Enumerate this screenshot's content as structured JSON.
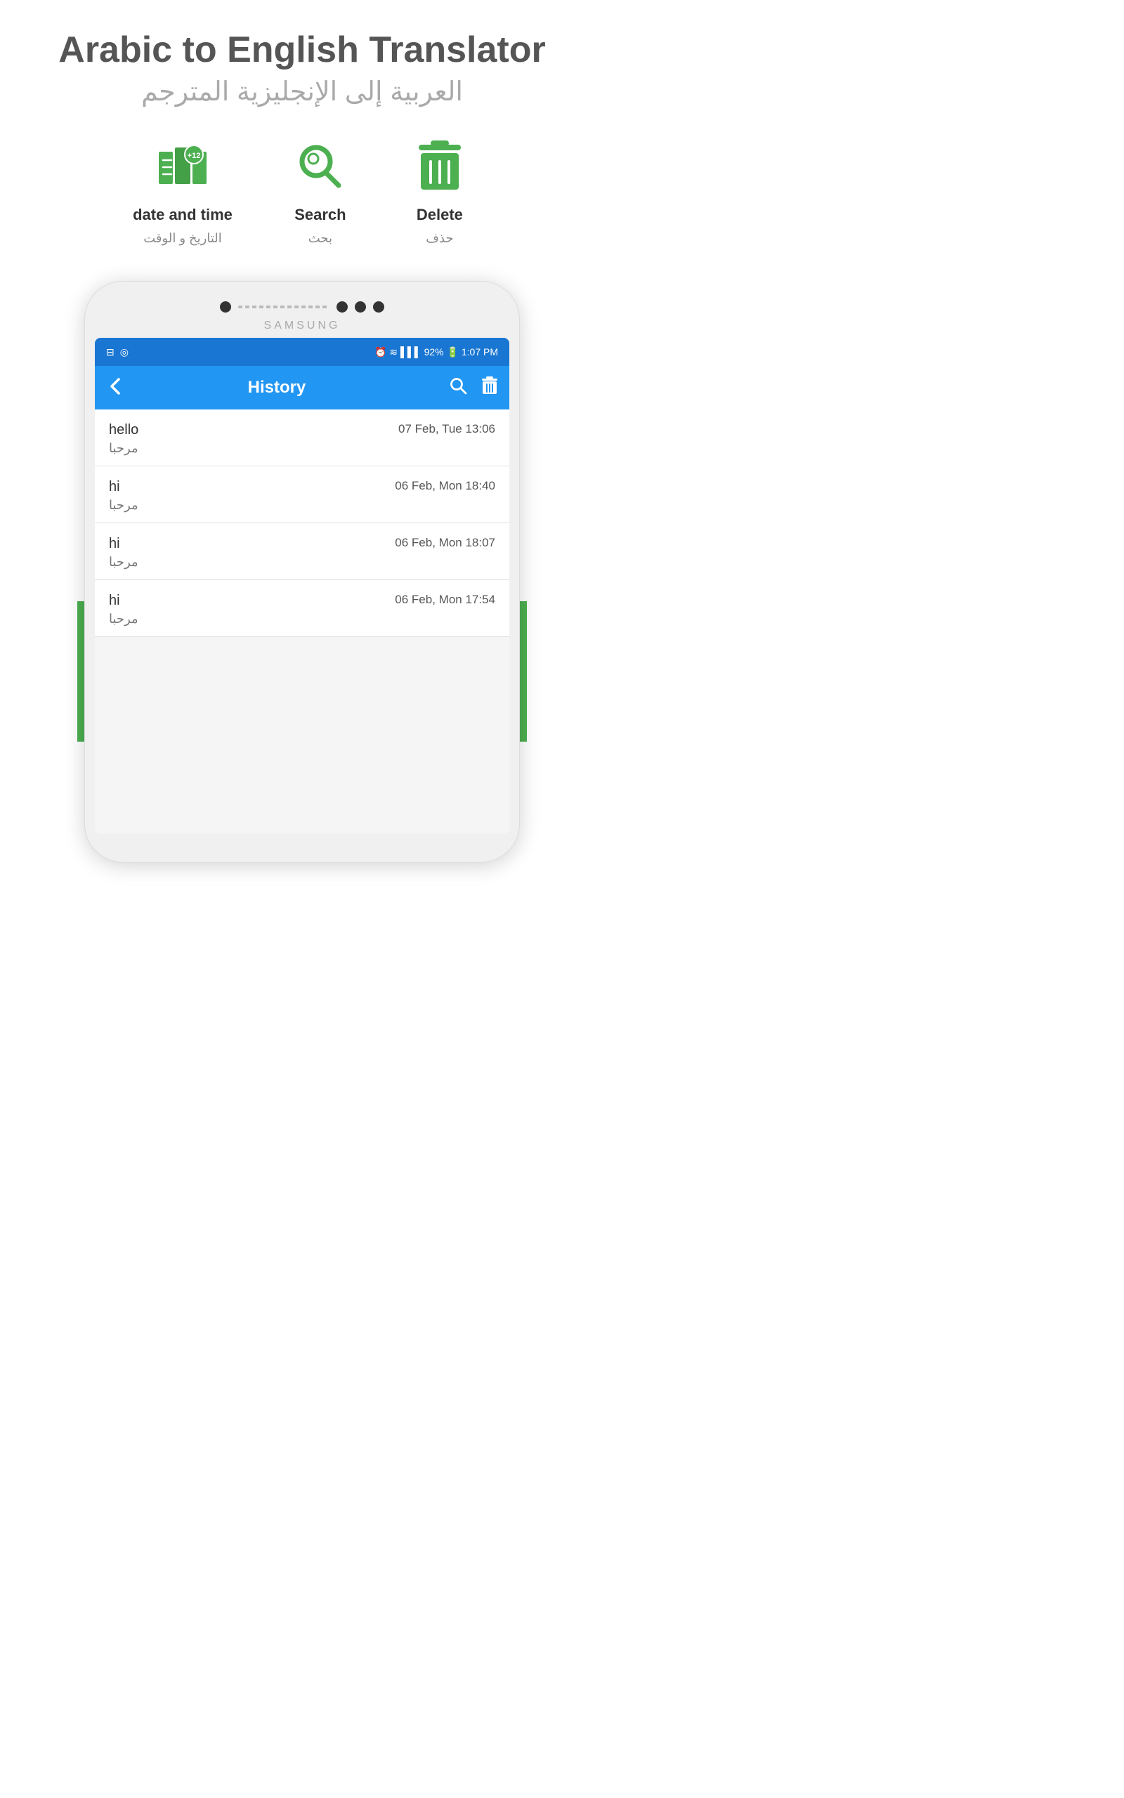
{
  "title": {
    "english": "Arabic to English Translator",
    "arabic": "العربية إلى الإنجليزية المترجم"
  },
  "features": [
    {
      "id": "datetime",
      "label_en": "date and time",
      "label_ar": "التاريخ و الوقت",
      "icon": "map-icon"
    },
    {
      "id": "search",
      "label_en": "Search",
      "label_ar": "بحث",
      "icon": "search-icon"
    },
    {
      "id": "delete",
      "label_en": "Delete",
      "label_ar": "حذف",
      "icon": "delete-icon"
    }
  ],
  "phone": {
    "brand": "SAMSUNG",
    "status_bar": {
      "battery": "92%",
      "time": "1:07 PM"
    },
    "app_bar": {
      "title": "History",
      "back_icon": "←",
      "search_icon": "🔍",
      "delete_icon": "🗑"
    },
    "history_items": [
      {
        "word": "hello",
        "translation": "مرحبا",
        "date": "07 Feb, Tue 13:06"
      },
      {
        "word": "hi",
        "translation": "مرحبا",
        "date": "06 Feb, Mon 18:40"
      },
      {
        "word": "hi",
        "translation": "مرحبا",
        "date": "06 Feb, Mon 18:07"
      },
      {
        "word": "hi",
        "translation": "مرحبا",
        "date": "06 Feb, Mon 17:54"
      }
    ]
  },
  "colors": {
    "green": "#4CAF50",
    "blue": "#2196F3",
    "dark_blue": "#1976d2"
  }
}
